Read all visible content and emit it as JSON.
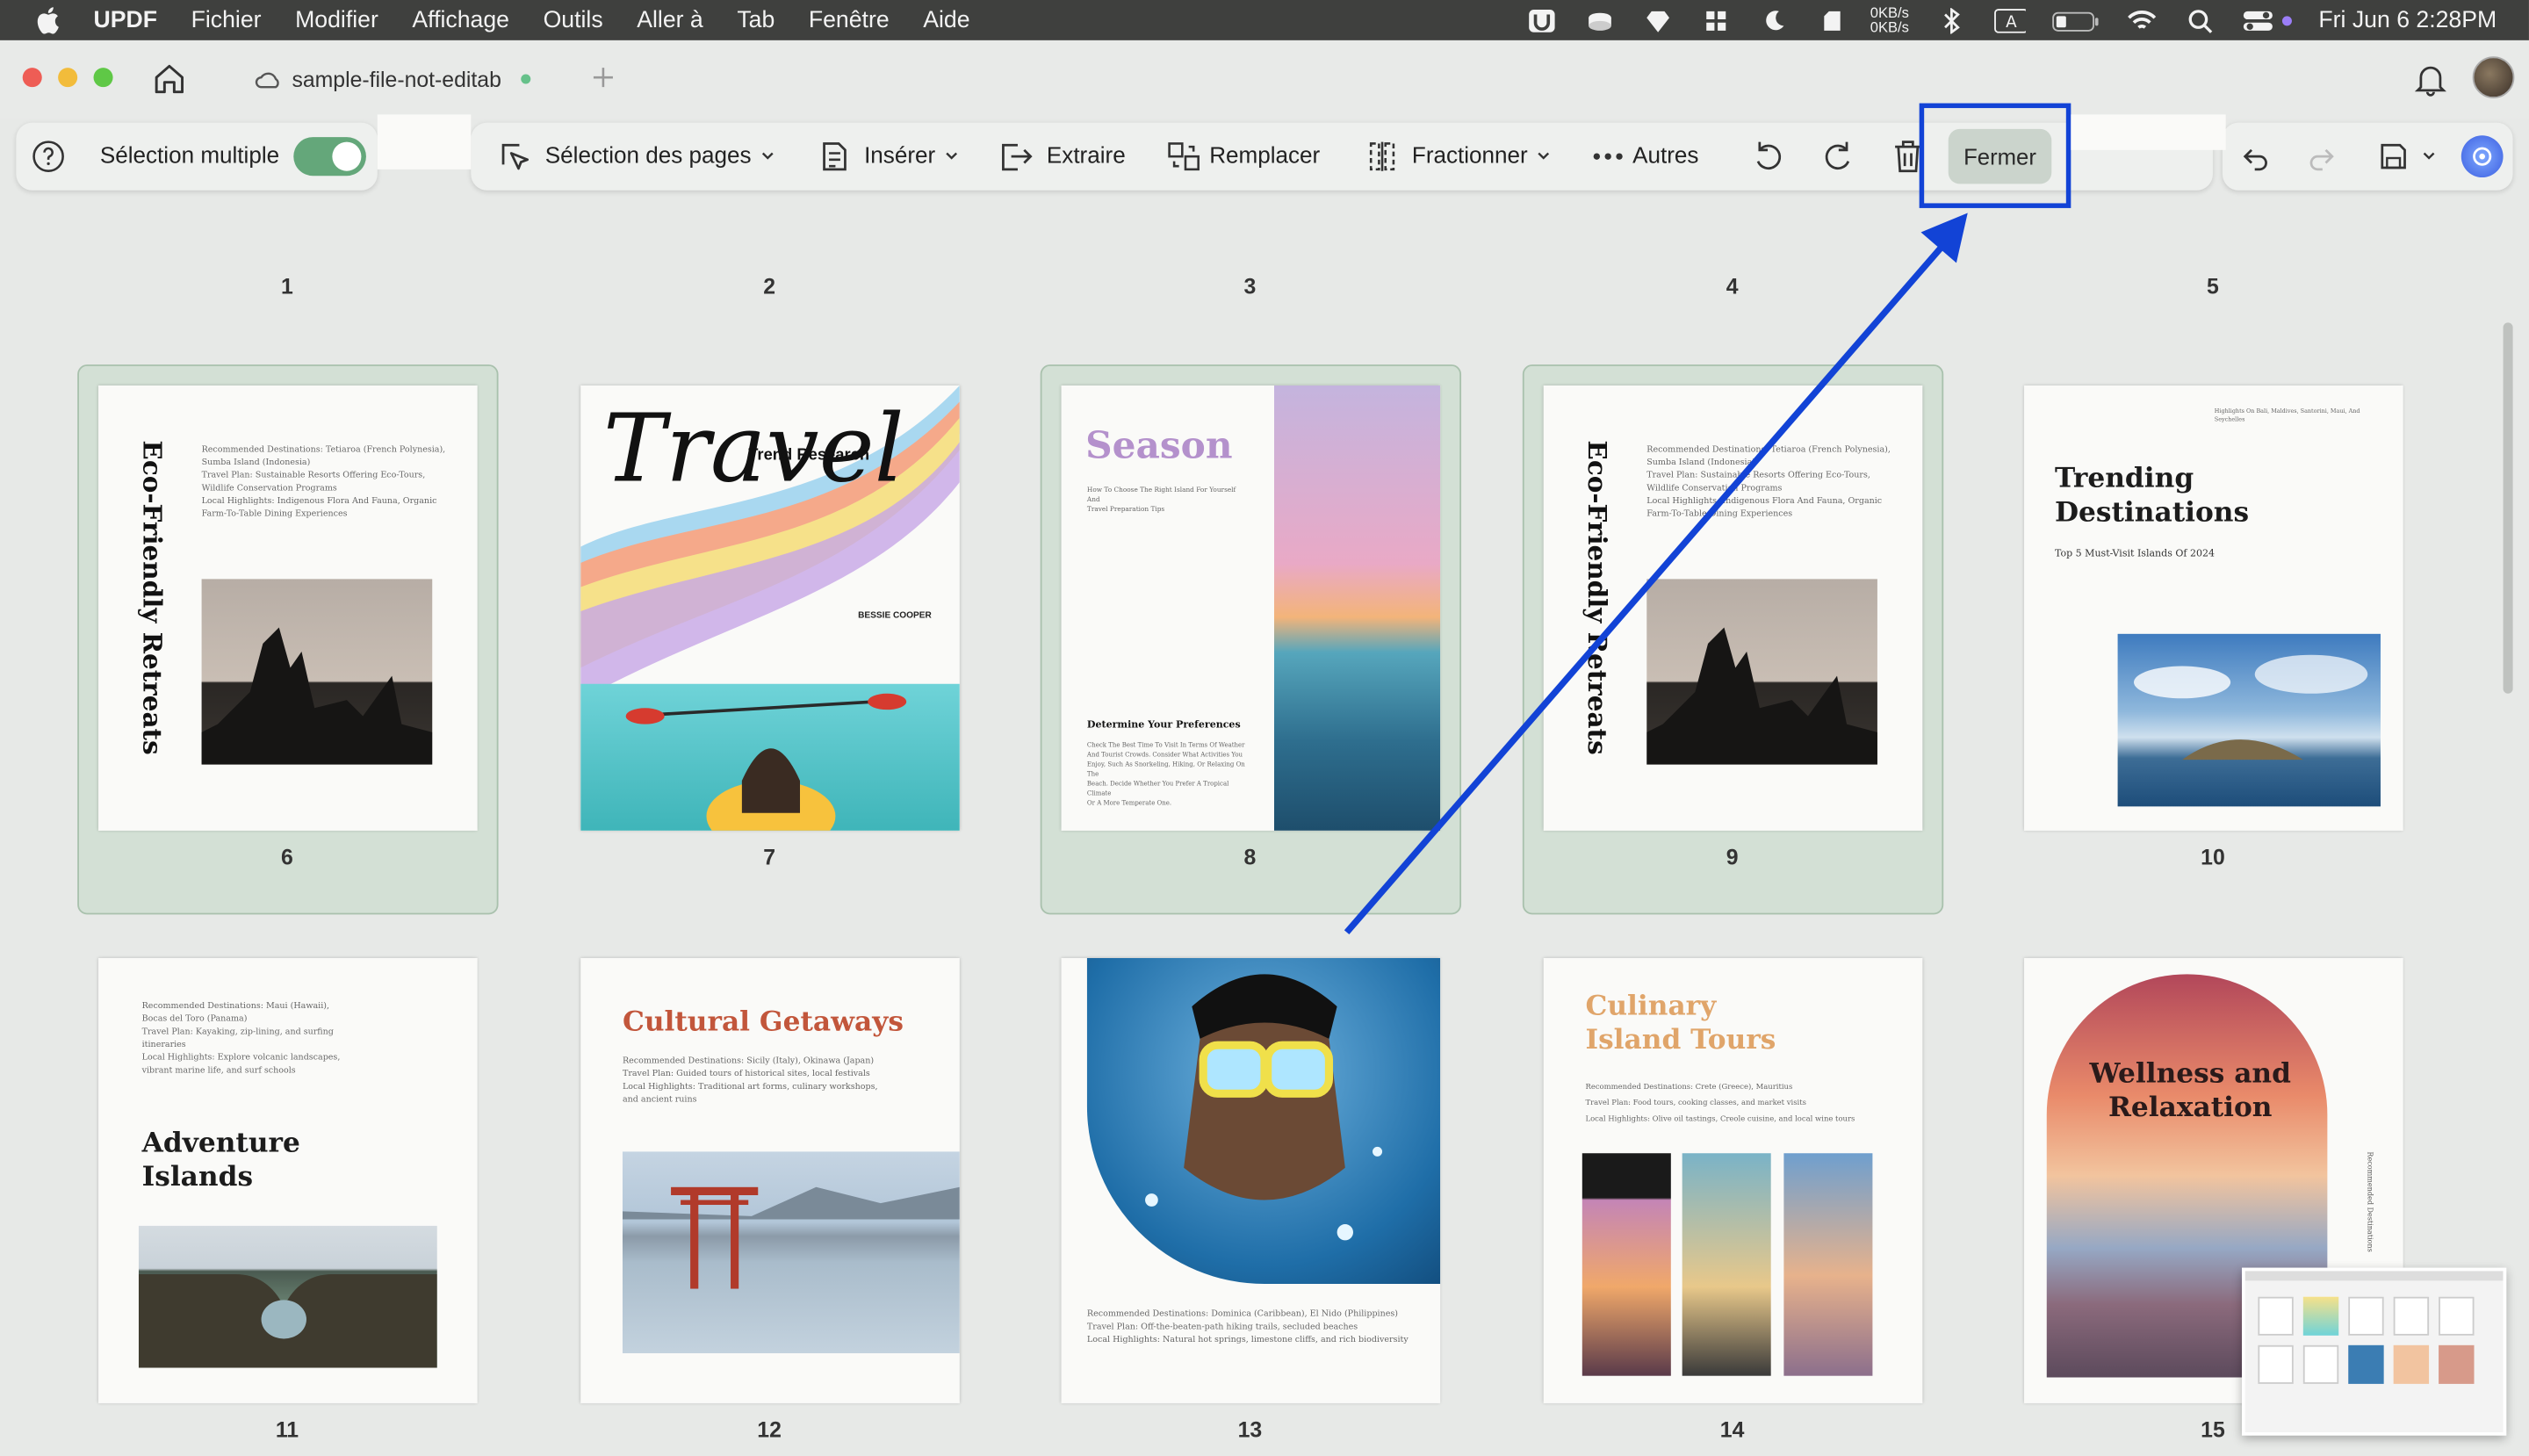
{
  "menubar": {
    "app_name": "UPDF",
    "items": [
      "Fichier",
      "Modifier",
      "Affichage",
      "Outils",
      "Aller à",
      "Tab",
      "Fenêtre",
      "Aide"
    ],
    "net_up": "0KB/s",
    "net_down": "0KB/s",
    "clock": "Fri Jun 6  2:28PM"
  },
  "tab": {
    "title": "sample-file-not-editab"
  },
  "toolbar": {
    "multi_select_label": "Sélection multiple",
    "multi_select_on": true,
    "page_selection_label": "Sélection des pages",
    "insert_label": "Insérer",
    "extract_label": "Extraire",
    "replace_label": "Remplacer",
    "split_label": "Fractionner",
    "more_label": "Autres",
    "close_label": "Fermer"
  },
  "colors": {
    "accent": "#64a77a",
    "annotation": "#1243d6",
    "selection_bg": "#d3e0d5"
  },
  "row0_numbers": [
    "1",
    "2",
    "3",
    "4",
    "5"
  ],
  "pages": [
    {
      "number": "6",
      "selected": true,
      "vertical_title": "Eco-Friendly Retreats",
      "lines": [
        "Recommended Destinations: Tetiaroa (French Polynesia),",
        "Sumba Island (Indonesia)",
        "Travel Plan: Sustainable Resorts Offering Eco-Tours,",
        "Wildlife Conservation Programs",
        "Local Highlights: Indigenous Flora And Fauna, Organic",
        "Farm-To-Table Dining Experiences"
      ]
    },
    {
      "number": "7",
      "selected": false,
      "title": "Travel",
      "subtitle": "Trend Research",
      "author": "BESSIE COOPER"
    },
    {
      "number": "8",
      "selected": true,
      "title": "Season",
      "heading": "Determine Your Preferences"
    },
    {
      "number": "9",
      "selected": true,
      "vertical_title": "Eco-Friendly Retreats"
    },
    {
      "number": "10",
      "selected": false,
      "title": "Trending Destinations",
      "subtitle": "Top 5 Must-Visit Islands Of 2024"
    },
    {
      "number": "11",
      "selected": false,
      "title": "Adventure Islands",
      "lines": [
        "Recommended Destinations: Maui (Hawaii),",
        "Bocas del Toro (Panama)",
        "Travel Plan: Kayaking, zip-lining, and surfing",
        "itineraries",
        "Local Highlights: Explore volcanic landscapes,",
        "vibrant marine life, and surf schools"
      ]
    },
    {
      "number": "12",
      "selected": false,
      "title": "Cultural Getaways",
      "lines": [
        "Recommended Destinations: Sicily (Italy), Okinawa (Japan)",
        "Travel Plan: Guided tours of historical sites, local festivals",
        "Local Highlights: Traditional art forms, culinary workshops,",
        "and ancient ruins"
      ]
    },
    {
      "number": "13",
      "selected": false,
      "lines": [
        "Recommended Destinations: Dominica (Caribbean), El Nido (Philippines)",
        "Travel Plan: Off-the-beaten-path hiking trails, secluded beaches",
        "Local Highlights: Natural hot springs, limestone cliffs, and rich biodiversity"
      ]
    },
    {
      "number": "14",
      "selected": false,
      "title": "Culinary Island Tours",
      "lines": [
        "Recommended Destinations: Crete (Greece), Mauritius",
        "Travel Plan: Food tours, cooking classes, and market visits",
        "Local Highlights: Olive oil tastings, Creole cuisine, and local wine tours"
      ]
    },
    {
      "number": "15",
      "selected": false,
      "title": "Wellness and Relaxation",
      "side_text": "Recommended Destinations"
    }
  ]
}
